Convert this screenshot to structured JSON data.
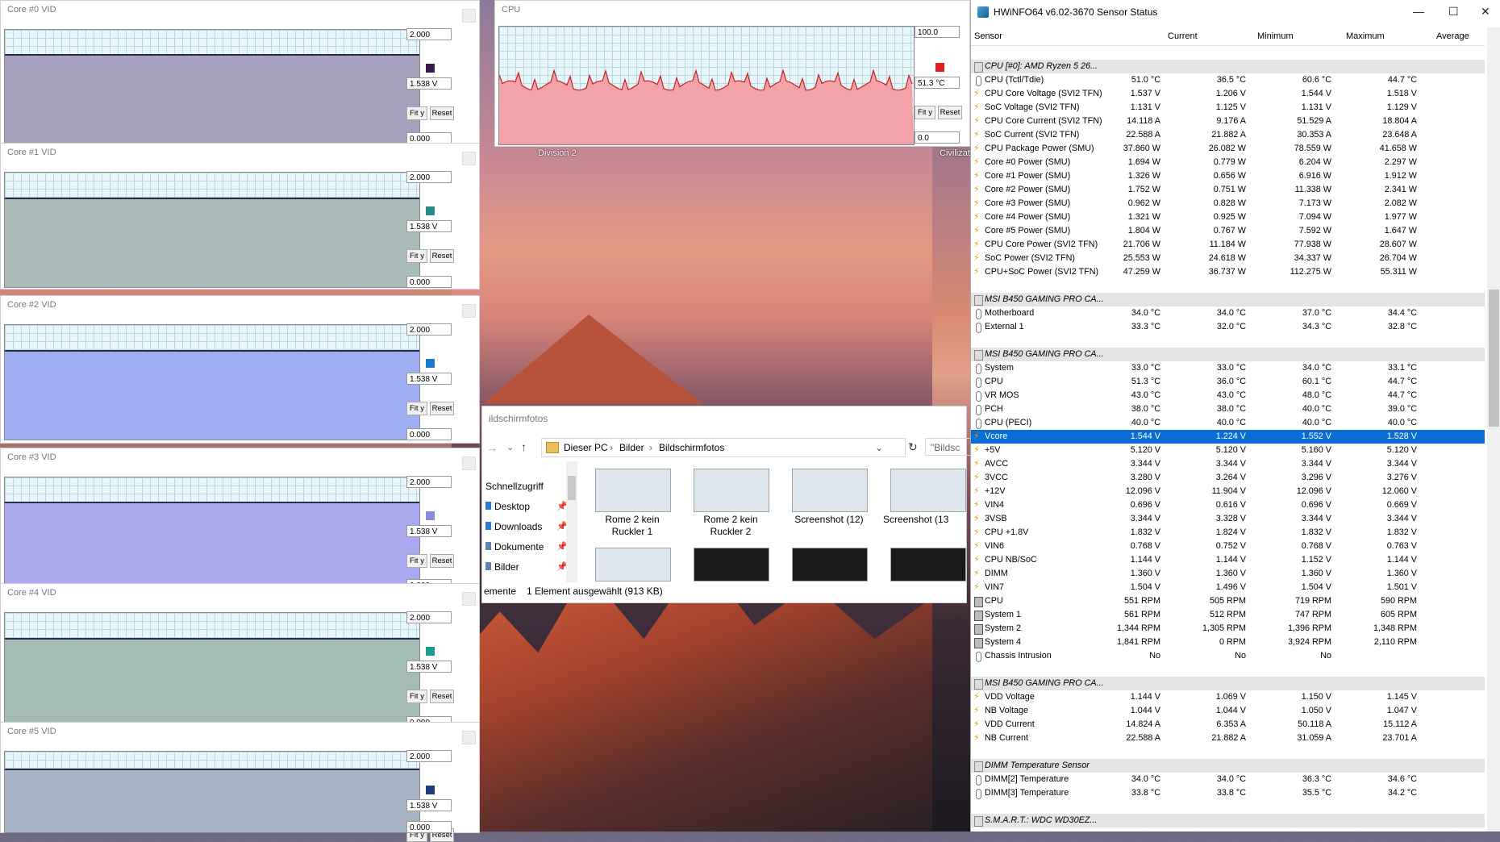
{
  "desktop": {
    "labels": [
      "Division 2",
      "Civilizati"
    ]
  },
  "graphs": [
    {
      "title": "Core #0 VID",
      "max": "2.000",
      "current": "1.538 V",
      "min": "0.000",
      "color": "#3a1a4a",
      "fill": "#a7a0bd",
      "level": 0.77
    },
    {
      "title": "Core #1 VID",
      "max": "2.000",
      "current": "1.538 V",
      "min": "0.000",
      "color": "#2a8a88",
      "fill": "#a8bbb9",
      "level": 0.77
    },
    {
      "title": "Core #2 VID",
      "max": "2.000",
      "current": "1.538 V",
      "min": "0.000",
      "color": "#1a7ad0",
      "fill": "#9fb0f2",
      "level": 0.77
    },
    {
      "title": "Core #3 VID",
      "max": "2.000",
      "current": "1.538 V",
      "min": "0.000",
      "color": "#8a8ad8",
      "fill": "#aaa8ee",
      "level": 0.77
    },
    {
      "title": "Core #4 VID",
      "max": "2.000",
      "current": "1.538 V",
      "min": "0.000",
      "color": "#1a9a8a",
      "fill": "#a3bcb6",
      "level": 0.77
    },
    {
      "title": "Core #5 VID",
      "max": "2.000",
      "current": "1.538 V",
      "min": "0.000",
      "color": "#1a3f7a",
      "fill": "#a7b4c6",
      "level": 0.77
    }
  ],
  "cpu_graph": {
    "title": "CPU",
    "max": "100.0",
    "current": "51.3 °C",
    "min": "0.0",
    "color": "#e02020",
    "fill": "#f3a3a8",
    "level": 0.5
  },
  "buttons": {
    "fit": "Fit y",
    "reset": "Reset"
  },
  "explorer": {
    "title": "ildschirmfotos",
    "breadcrumb": [
      "Dieser PC",
      "Bilder",
      "Bildschirmfotos"
    ],
    "search_placeholder": "\"Bildsc",
    "nav": [
      "Schnellzugriff",
      "Desktop",
      "Downloads",
      "Dokumente",
      "Bilder"
    ],
    "files": [
      "Rome 2 kein Ruckler 1",
      "Rome 2 kein Ruckler 2",
      "Screenshot (12)",
      "Screenshot (13"
    ],
    "status_left": "emente",
    "status_right": "1 Element ausgewählt (913 KB)"
  },
  "hwinfo": {
    "title": "HWiNFO64 v6.02-3670 Sensor Status",
    "columns": [
      "Sensor",
      "Current",
      "Minimum",
      "Maximum",
      "Average"
    ],
    "groups": [
      {
        "name": "CPU [#0]: AMD Ryzen 5 26...",
        "rows": [
          [
            "t",
            "CPU (Tctl/Tdie)",
            "51.0 °C",
            "36.5 °C",
            "60.6 °C",
            "44.7 °C"
          ],
          [
            "v",
            "CPU Core Voltage (SVI2 TFN)",
            "1.537 V",
            "1.206 V",
            "1.544 V",
            "1.518 V"
          ],
          [
            "v",
            "SoC Voltage (SVI2 TFN)",
            "1.131 V",
            "1.125 V",
            "1.131 V",
            "1.129 V"
          ],
          [
            "v",
            "CPU Core Current (SVI2 TFN)",
            "14.118 A",
            "9.176 A",
            "51.529 A",
            "18.804 A"
          ],
          [
            "v",
            "SoC Current (SVI2 TFN)",
            "22.588 A",
            "21.882 A",
            "30.353 A",
            "23.648 A"
          ],
          [
            "v",
            "CPU Package Power (SMU)",
            "37.860 W",
            "26.082 W",
            "78.559 W",
            "41.658 W"
          ],
          [
            "v",
            "Core #0 Power (SMU)",
            "1.694 W",
            "0.779 W",
            "6.204 W",
            "2.297 W"
          ],
          [
            "v",
            "Core #1 Power (SMU)",
            "1.326 W",
            "0.656 W",
            "6.916 W",
            "1.912 W"
          ],
          [
            "v",
            "Core #2 Power (SMU)",
            "1.752 W",
            "0.751 W",
            "11.338 W",
            "2.341 W"
          ],
          [
            "v",
            "Core #3 Power (SMU)",
            "0.962 W",
            "0.828 W",
            "7.173 W",
            "2.082 W"
          ],
          [
            "v",
            "Core #4 Power (SMU)",
            "1.321 W",
            "0.925 W",
            "7.094 W",
            "1.977 W"
          ],
          [
            "v",
            "Core #5 Power (SMU)",
            "1.804 W",
            "0.767 W",
            "7.592 W",
            "1.647 W"
          ],
          [
            "v",
            "CPU Core Power (SVI2 TFN)",
            "21.706 W",
            "11.184 W",
            "77.938 W",
            "28.607 W"
          ],
          [
            "v",
            "SoC Power (SVI2 TFN)",
            "25.553 W",
            "24.618 W",
            "34.337 W",
            "26.704 W"
          ],
          [
            "v",
            "CPU+SoC Power (SVI2 TFN)",
            "47.259 W",
            "36.737 W",
            "112.275 W",
            "55.311 W"
          ]
        ]
      },
      {
        "name": "MSI B450 GAMING PRO CA...",
        "rows": [
          [
            "t",
            "Motherboard",
            "34.0 °C",
            "34.0 °C",
            "37.0 °C",
            "34.4 °C"
          ],
          [
            "t",
            "External 1",
            "33.3 °C",
            "32.0 °C",
            "34.3 °C",
            "32.8 °C"
          ]
        ]
      },
      {
        "name": "MSI B450 GAMING PRO CA...",
        "rows": [
          [
            "t",
            "System",
            "33.0 °C",
            "33.0 °C",
            "34.0 °C",
            "33.1 °C"
          ],
          [
            "t",
            "CPU",
            "51.3 °C",
            "36.0 °C",
            "60.1 °C",
            "44.7 °C"
          ],
          [
            "t",
            "VR MOS",
            "43.0 °C",
            "43.0 °C",
            "48.0 °C",
            "44.7 °C"
          ],
          [
            "t",
            "PCH",
            "38.0 °C",
            "38.0 °C",
            "40.0 °C",
            "39.0 °C"
          ],
          [
            "t",
            "CPU (PECI)",
            "40.0 °C",
            "40.0 °C",
            "40.0 °C",
            "40.0 °C"
          ],
          [
            "v",
            "Vcore",
            "1.544 V",
            "1.224 V",
            "1.552 V",
            "1.528 V"
          ],
          [
            "v",
            "+5V",
            "5.120 V",
            "5.120 V",
            "5.160 V",
            "5.120 V"
          ],
          [
            "v",
            "AVCC",
            "3.344 V",
            "3.344 V",
            "3.344 V",
            "3.344 V"
          ],
          [
            "v",
            "3VCC",
            "3.280 V",
            "3.264 V",
            "3.296 V",
            "3.276 V"
          ],
          [
            "v",
            "+12V",
            "12.096 V",
            "11.904 V",
            "12.096 V",
            "12.060 V"
          ],
          [
            "v",
            "VIN4",
            "0.696 V",
            "0.616 V",
            "0.696 V",
            "0.669 V"
          ],
          [
            "v",
            "3VSB",
            "3.344 V",
            "3.328 V",
            "3.344 V",
            "3.344 V"
          ],
          [
            "v",
            "CPU +1.8V",
            "1.832 V",
            "1.824 V",
            "1.832 V",
            "1.832 V"
          ],
          [
            "v",
            "VIN6",
            "0.768 V",
            "0.752 V",
            "0.768 V",
            "0.763 V"
          ],
          [
            "v",
            "CPU NB/SoC",
            "1.144 V",
            "1.144 V",
            "1.152 V",
            "1.144 V"
          ],
          [
            "v",
            "DIMM",
            "1.360 V",
            "1.360 V",
            "1.360 V",
            "1.360 V"
          ],
          [
            "v",
            "VIN7",
            "1.504 V",
            "1.496 V",
            "1.504 V",
            "1.501 V"
          ],
          [
            "f",
            "CPU",
            "551 RPM",
            "505 RPM",
            "719 RPM",
            "590 RPM"
          ],
          [
            "f",
            "System 1",
            "561 RPM",
            "512 RPM",
            "747 RPM",
            "605 RPM"
          ],
          [
            "f",
            "System 2",
            "1,344 RPM",
            "1,305 RPM",
            "1,396 RPM",
            "1,348 RPM"
          ],
          [
            "f",
            "System 4",
            "1,841 RPM",
            "0 RPM",
            "3,924 RPM",
            "2,110 RPM"
          ],
          [
            "c",
            "Chassis Intrusion",
            "No",
            "No",
            "No",
            ""
          ]
        ]
      },
      {
        "name": "MSI B450 GAMING PRO CA...",
        "rows": [
          [
            "v",
            "VDD Voltage",
            "1.144 V",
            "1.069 V",
            "1.150 V",
            "1.145 V"
          ],
          [
            "v",
            "NB Voltage",
            "1.044 V",
            "1.044 V",
            "1.050 V",
            "1.047 V"
          ],
          [
            "v",
            "VDD Current",
            "14.824 A",
            "6.353 A",
            "50.118 A",
            "15.112 A"
          ],
          [
            "v",
            "NB Current",
            "22.588 A",
            "21.882 A",
            "31.059 A",
            "23.701 A"
          ]
        ]
      },
      {
        "name": "DIMM Temperature Sensor",
        "rows": [
          [
            "t",
            "DIMM[2] Temperature",
            "34.0 °C",
            "34.0 °C",
            "36.3 °C",
            "34.6 °C"
          ],
          [
            "t",
            "DIMM[3] Temperature",
            "33.8 °C",
            "33.8 °C",
            "35.5 °C",
            "34.2 °C"
          ]
        ]
      },
      {
        "name": "S.M.A.R.T.: WDC WD30EZ...",
        "rows": []
      }
    ],
    "selected": "Vcore"
  }
}
